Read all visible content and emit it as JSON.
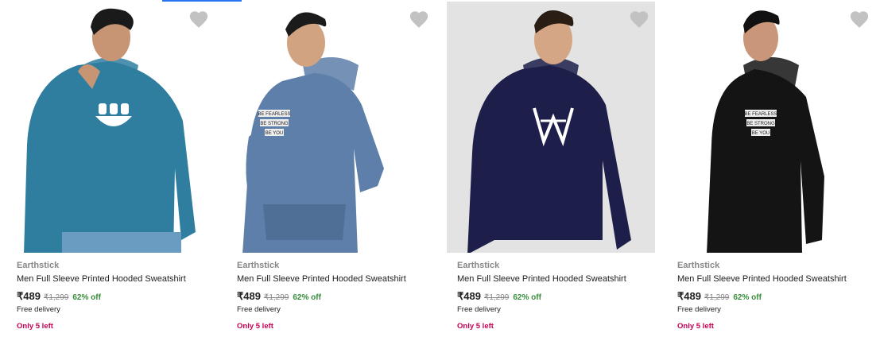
{
  "accent": "#2874f0",
  "products": [
    {
      "brand": "Earthstick",
      "title": "Men Full Sleeve Printed Hooded Sweatshirt",
      "price": "₹489",
      "mrp": "₹1,299",
      "discount": "62% off",
      "delivery": "Free delivery",
      "stock": "Only 5 left",
      "image": "teal-hoodie-print",
      "color": "#2f7ea0",
      "bg": "#ffffff",
      "skin": "#c79574"
    },
    {
      "brand": "Earthstick",
      "title": "Men Full Sleeve Printed Hooded Sweatshirt",
      "price": "₹489",
      "mrp": "₹1,299",
      "discount": "62% off",
      "delivery": "Free delivery",
      "stock": "Only 5 left",
      "image": "blue-grey-hoodie-text-print",
      "color": "#5d7fa9",
      "bg": "#ffffff",
      "skin": "#d2a381"
    },
    {
      "brand": "Earthstick",
      "title": "Men Full Sleeve Printed Hooded Sweatshirt",
      "price": "₹489",
      "mrp": "₹1,299",
      "discount": "62% off",
      "delivery": "Free delivery",
      "stock": "Only 5 left",
      "image": "navy-hoodie-logo",
      "color": "#1d1f4a",
      "bg": "#e3e3e3",
      "skin": "#d4a685"
    },
    {
      "brand": "Earthstick",
      "title": "Men Full Sleeve Printed Hooded Sweatshirt",
      "price": "₹489",
      "mrp": "₹1,299",
      "discount": "62% off",
      "delivery": "Free delivery",
      "stock": "Only 5 left",
      "image": "black-hoodie-text-print",
      "color": "#141414",
      "bg": "#ffffff",
      "skin": "#c9967a"
    }
  ]
}
